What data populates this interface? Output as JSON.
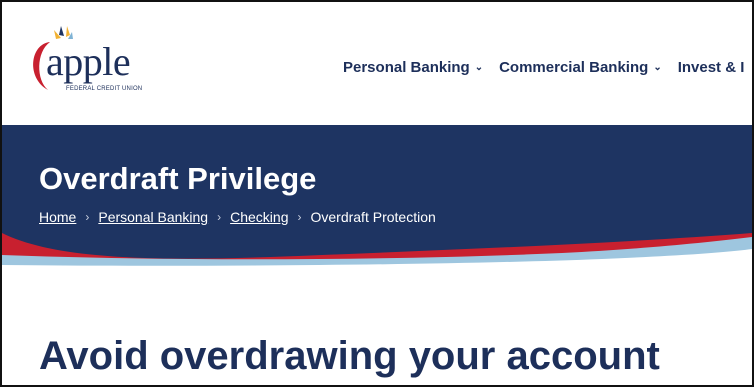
{
  "brand": {
    "name": "apple",
    "tagline": "FEDERAL CREDIT UNION",
    "colors": {
      "navy": "#1e3462",
      "red": "#c8202f",
      "light_blue": "#9ec6df",
      "logo_yellow": "#f2b233"
    }
  },
  "nav": {
    "items": [
      {
        "label": "Personal Banking",
        "chevron": "chevron-down-icon"
      },
      {
        "label": "Commercial Banking",
        "chevron": "chevron-down-icon"
      },
      {
        "label": "Invest & I"
      }
    ]
  },
  "banner": {
    "title": "Overdraft Privilege",
    "breadcrumb": [
      {
        "label": "Home",
        "link": true
      },
      {
        "label": "Personal Banking",
        "link": true
      },
      {
        "label": "Checking",
        "link": true
      },
      {
        "label": "Overdraft Protection",
        "link": false
      }
    ],
    "separator": "›"
  },
  "main": {
    "heading": "Avoid overdrawing your account"
  }
}
